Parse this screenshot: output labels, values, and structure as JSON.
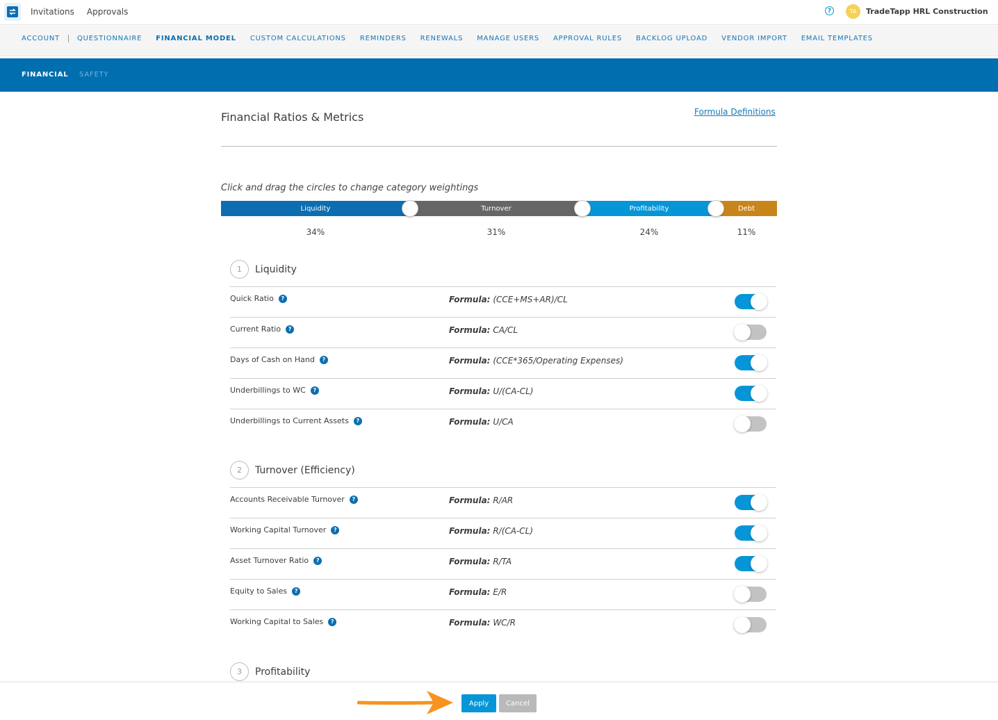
{
  "topbar": {
    "nav": [
      "Invitations",
      "Approvals"
    ],
    "company": "TradeTapp HRL Construction",
    "avatar_initials": "TA",
    "help_glyph": "?"
  },
  "admin_nav": [
    "ACCOUNT",
    "QUESTIONNAIRE",
    "FINANCIAL MODEL",
    "CUSTOM CALCULATIONS",
    "REMINDERS",
    "RENEWALS",
    "MANAGE USERS",
    "APPROVAL RULES",
    "BACKLOG UPLOAD",
    "VENDOR IMPORT",
    "EMAIL TEMPLATES"
  ],
  "admin_nav_active": "FINANCIAL MODEL",
  "sub_nav": {
    "financial": "FINANCIAL",
    "safety": "SAFETY"
  },
  "page": {
    "title": "Financial Ratios & Metrics",
    "formula_link": "Formula Definitions",
    "instruction": "Click and drag the circles to change category weightings"
  },
  "weights": [
    {
      "label": "Liquidity",
      "percent": 34,
      "percent_text": "34%",
      "color": "#0c6eb1"
    },
    {
      "label": "Turnover",
      "percent": 31,
      "percent_text": "31%",
      "color": "#666666"
    },
    {
      "label": "Profitability",
      "percent": 24,
      "percent_text": "24%",
      "color": "#0696d7"
    },
    {
      "label": "Debt",
      "percent": 11,
      "percent_text": "11%",
      "color": "#c8861a"
    }
  ],
  "formula_prefix": "Formula:",
  "sections": [
    {
      "number": "1",
      "title": "Liquidity",
      "metrics": [
        {
          "name": "Quick Ratio",
          "formula": "(CCE+MS+AR)/CL",
          "enabled": true
        },
        {
          "name": "Current Ratio",
          "formula": "CA/CL",
          "enabled": false
        },
        {
          "name": "Days of Cash on Hand",
          "formula": "(CCE*365/Operating Expenses)",
          "enabled": true
        },
        {
          "name": "Underbillings to WC",
          "formula": "U/(CA-CL)",
          "enabled": true
        },
        {
          "name": "Underbillings to Current Assets",
          "formula": "U/CA",
          "enabled": false
        }
      ]
    },
    {
      "number": "2",
      "title": "Turnover (Efficiency)",
      "metrics": [
        {
          "name": "Accounts Receivable Turnover",
          "formula": "R/AR",
          "enabled": true
        },
        {
          "name": "Working Capital Turnover",
          "formula": "R/(CA-CL)",
          "enabled": true
        },
        {
          "name": "Asset Turnover Ratio",
          "formula": "R/TA",
          "enabled": true
        },
        {
          "name": "Equity to Sales",
          "formula": "E/R",
          "enabled": false
        },
        {
          "name": "Working Capital to Sales",
          "formula": "WC/R",
          "enabled": false
        }
      ]
    },
    {
      "number": "3",
      "title": "Profitability",
      "metrics": []
    }
  ],
  "footer": {
    "apply": "Apply",
    "cancel": "Cancel"
  },
  "colors": {
    "accent": "#0696d7",
    "brand": "#006eaf",
    "annotation_arrow": "#f7931e"
  }
}
